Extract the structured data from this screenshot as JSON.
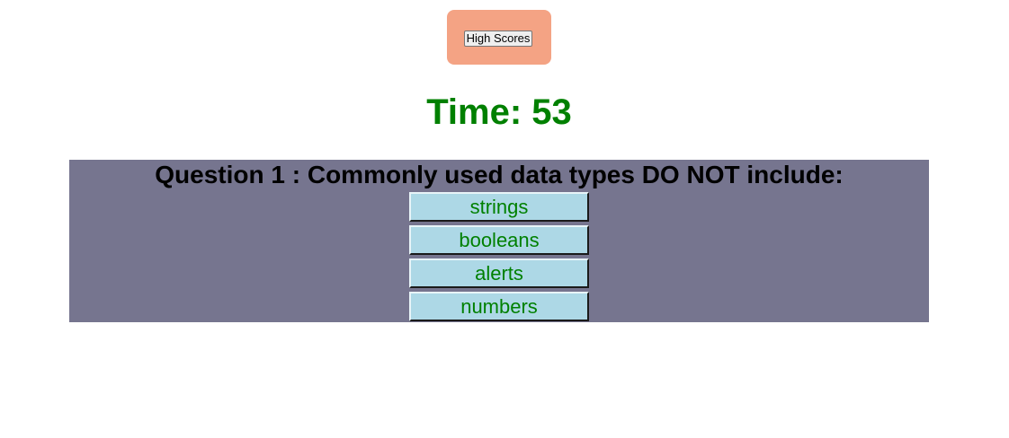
{
  "header": {
    "high_scores_label": "High Scores"
  },
  "timer": {
    "label": "Time: 53"
  },
  "quiz": {
    "question_text": "Question 1 : Commonly used data types DO NOT include:",
    "answers": [
      {
        "label": "strings"
      },
      {
        "label": "booleans"
      },
      {
        "label": "alerts"
      },
      {
        "label": "numbers"
      }
    ]
  },
  "colors": {
    "high_scores_box": "#f4a384",
    "timer_text": "#008000",
    "quiz_background": "#76758f",
    "answer_background": "#add8e6",
    "answer_text": "#008000"
  }
}
